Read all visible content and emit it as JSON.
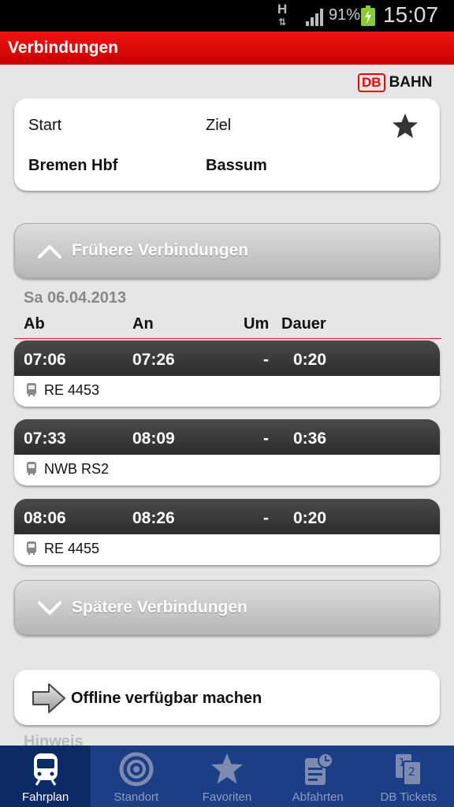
{
  "status_bar": {
    "network": "H",
    "battery": "91%",
    "time": "15:07"
  },
  "app": {
    "title": "Verbindungen",
    "logo_box": "DB",
    "logo_word": "BAHN"
  },
  "route": {
    "start_label": "Start",
    "start_value": "Bremen Hbf",
    "dest_label": "Ziel",
    "dest_value": "Bassum"
  },
  "earlier_label": "Frühere Verbindungen",
  "later_label": "Spätere Verbindungen",
  "date": "Sa 06.04.2013",
  "columns": {
    "dep": "Ab",
    "arr": "An",
    "changes": "Um",
    "duration": "Dauer"
  },
  "connections": [
    {
      "dep": "07:06",
      "arr": "07:26",
      "changes": "-",
      "duration": "0:20",
      "train": "RE 4453"
    },
    {
      "dep": "07:33",
      "arr": "08:09",
      "changes": "-",
      "duration": "0:36",
      "train": "NWB RS2"
    },
    {
      "dep": "08:06",
      "arr": "08:26",
      "changes": "-",
      "duration": "0:20",
      "train": "RE 4455"
    }
  ],
  "offline_label": "Offline verfügbar machen",
  "hint_label": "Hinweis",
  "tabs": [
    {
      "label": "Fahrplan",
      "icon": "train-icon"
    },
    {
      "label": "Standort",
      "icon": "location-target-icon"
    },
    {
      "label": "Favoriten",
      "icon": "star-icon"
    },
    {
      "label": "Abfahrten",
      "icon": "departures-icon"
    },
    {
      "label": "DB Tickets",
      "icon": "tickets-icon"
    }
  ],
  "colors": {
    "title_bar": "#e00000",
    "tab_bar": "#1b3e86",
    "tab_active": "#0b2a66",
    "connection_header": "#333333"
  }
}
